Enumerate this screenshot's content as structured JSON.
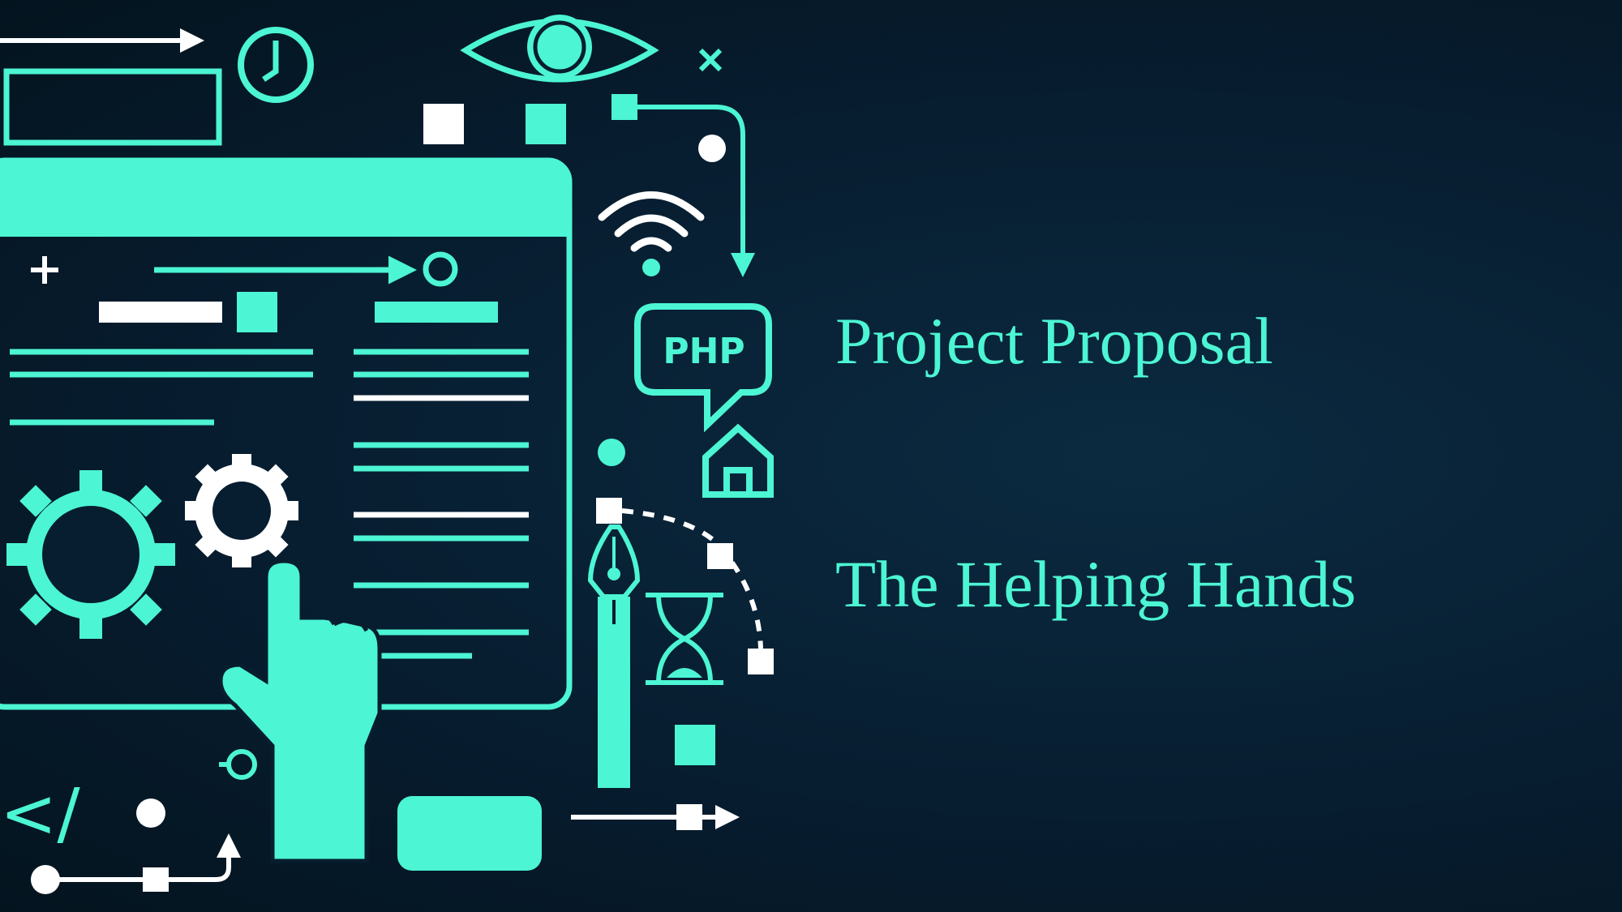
{
  "slide": {
    "title": "Project Proposal",
    "subtitle": "The Helping Hands"
  },
  "illustration": {
    "php_label": "PHP",
    "code_tag": "</"
  },
  "colors": {
    "accent": "#4cf5d3",
    "white": "#ffffff",
    "background": "#071d30"
  },
  "icons": [
    "clock-icon",
    "eye-icon",
    "close-icon",
    "wifi-icon",
    "php-speech-bubble-icon",
    "home-icon",
    "pen-nib-icon",
    "hourglass-icon",
    "gear-icon",
    "pointing-hand-icon",
    "code-tag-icon",
    "browser-window-icon"
  ]
}
